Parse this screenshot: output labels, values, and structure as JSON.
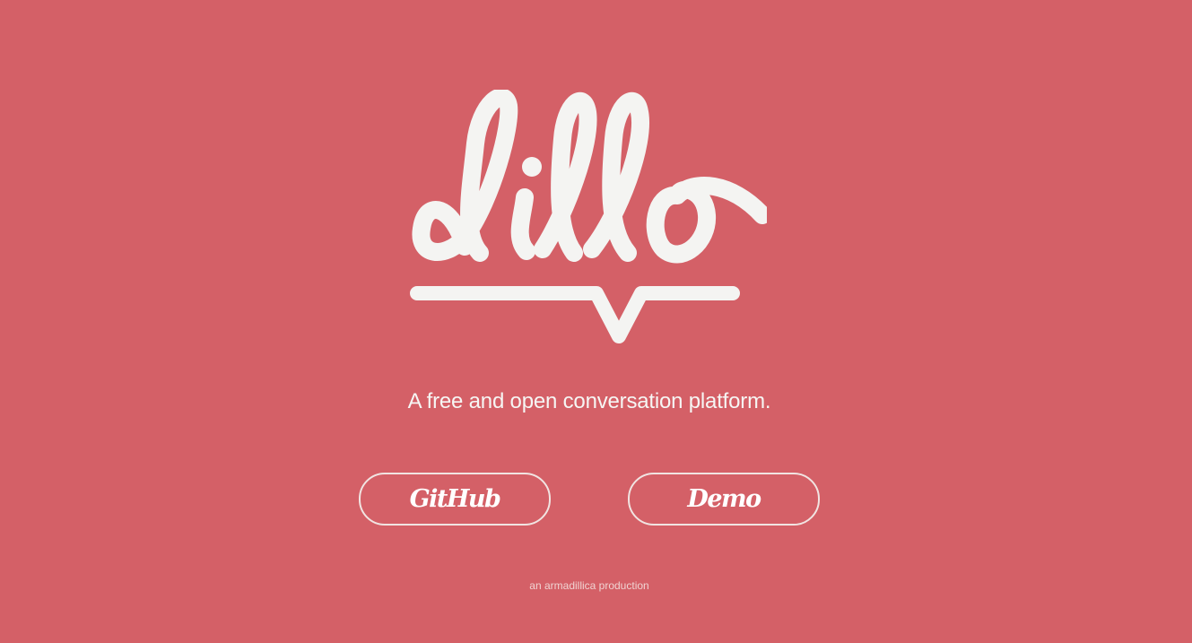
{
  "brand": {
    "logo_text": "dillo",
    "logo_color": "#f4f4f2"
  },
  "tagline": "A free and open conversation platform.",
  "buttons": {
    "github_label": "GitHub",
    "demo_label": "Demo"
  },
  "footer": {
    "credit": "an armadillica production"
  },
  "colors": {
    "background": "#d46067",
    "text": "#f6f6f4",
    "button_border": "#f1e4e2"
  }
}
